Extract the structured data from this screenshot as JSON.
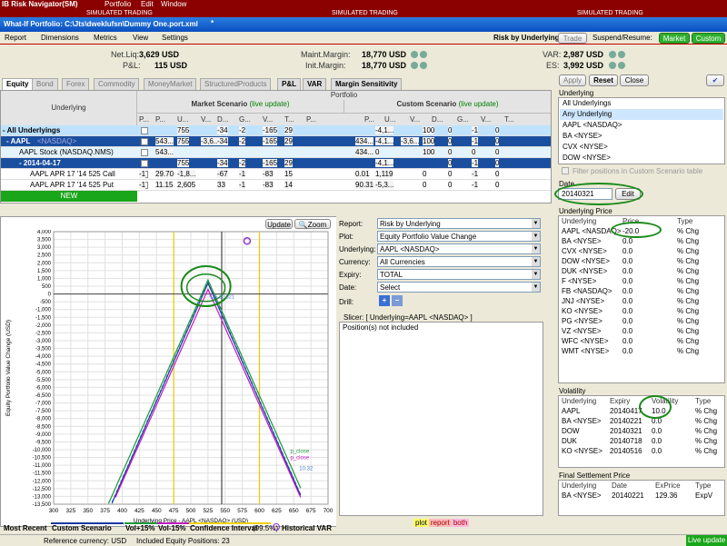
{
  "titlebar": {
    "title": "IB Risk Navigator(SM)",
    "menus": [
      "Portfolio",
      "Edit",
      "Window"
    ]
  },
  "simbar": {
    "label": "SIMULATED TRADING"
  },
  "window": {
    "title": "What-If Portfolio: C:\\Jts\\dweklufsn\\Dummy One.port.xml"
  },
  "menubar": {
    "items": [
      "Report",
      "Dimensions",
      "Metrics",
      "View",
      "Settings"
    ],
    "risk_label": "Risk by Underlying",
    "trade": "Trade",
    "suspend": "Suspend/Resume:",
    "market": "Market",
    "custom": "Custom"
  },
  "summary": {
    "netliq_l": "Net.Liq:",
    "netliq": "3,629 USD",
    "pl_l": "P&L:",
    "pl": "115 USD",
    "mm_l": "Maint.Margin:",
    "mm": "18,770 USD",
    "im_l": "Init.Margin:",
    "im": "18,770 USD",
    "var_l": "VAR:",
    "var": "2,987 USD",
    "es_l": "ES:",
    "es": "3,992 USD"
  },
  "tabs": [
    "Equity",
    "Bond",
    "Forex",
    "Commodity",
    "MoneyMarket",
    "StructuredProducts",
    "P&L",
    "VAR",
    "Margin Sensitivity"
  ],
  "grid": {
    "portfolio": "Portfolio",
    "underlying": "Underlying",
    "market": "Market Scenario",
    "custom": "Custom Scenario",
    "live": "(live update)",
    "mcols": [
      "P...",
      "P...",
      "U...",
      "V...",
      "D...",
      "G...",
      "V...",
      "T...",
      "P..."
    ],
    "ccols": [
      "P...",
      "U...",
      "V...",
      "D...",
      "G...",
      "V...",
      "T..."
    ],
    "rows": [
      {
        "name": "- All Underlyings",
        "m": [
          "",
          "",
          "755",
          "",
          "-34",
          "-2",
          "-165",
          "29",
          ""
        ],
        "c": [
          "",
          "-4,1...",
          "",
          "100",
          "0",
          "-1",
          "0"
        ]
      },
      {
        "name": "- AAPL",
        "sub": "<NASDAQ>",
        "m": [
          "",
          "543...",
          "755",
          "-3,6...",
          "-34",
          "-2",
          "-165",
          "29",
          ""
        ],
        "c": [
          "434...",
          "-4,1...",
          "-3,6...",
          "100",
          "0",
          "-1",
          "0"
        ]
      },
      {
        "name": "AAPL Stock (NASDAQ.NMS)",
        "m": [
          "",
          "543...",
          "",
          "",
          "",
          "",
          "",
          "",
          ""
        ],
        "c": [
          "434...",
          "0",
          "",
          "100",
          "0",
          "0",
          "0"
        ]
      },
      {
        "name": "- 2014-04-17",
        "m": [
          "",
          "",
          "755",
          "",
          "-34",
          "-2",
          "-165",
          "29",
          ""
        ],
        "c": [
          "",
          "-4,1...",
          "",
          "",
          "0",
          "-1",
          "0"
        ]
      },
      {
        "name": "AAPL APR 17 '14 525 Call",
        "m": [
          "-1",
          "29.70",
          "-1,8...",
          "",
          "-67",
          "-1",
          "-83",
          "15",
          ""
        ],
        "c": [
          "0.01",
          "1,119",
          "",
          "0",
          "0",
          "-1",
          "0"
        ]
      },
      {
        "name": "AAPL APR 17 '14 525 Put",
        "m": [
          "-1",
          "11.15",
          "2,605",
          "",
          "33",
          "-1",
          "-83",
          "14",
          ""
        ],
        "c": [
          "90.31",
          "-5,3...",
          "",
          "0",
          "0",
          "-1",
          "0"
        ]
      }
    ],
    "new": "NEW"
  },
  "chart": {
    "update": "Update",
    "zoom": "Zoom",
    "ylabel": "Equity Portfolio Value Change (USD)",
    "xlabel": "Underlying Price - AAPL <NASDAQ> (USD)",
    "yticks": [
      "4,000",
      "3,500",
      "3,000",
      "2,500",
      "2,000",
      "1,500",
      "1,000",
      "500",
      "0",
      "-500",
      "-1,000",
      "-1,500",
      "-2,000",
      "-2,500",
      "-3,000",
      "-3,500",
      "-4,000",
      "-4,500",
      "-5,000",
      "-5,500",
      "-6,000",
      "-6,500",
      "-7,000",
      "-7,500",
      "-8,000",
      "-8,500",
      "-9,000",
      "-9,500",
      "-10,000",
      "-10,500",
      "-11,000",
      "-11,500",
      "-12,000",
      "-12,500",
      "-13,000",
      "-13,500"
    ],
    "xticks": [
      "300",
      "325",
      "350",
      "375",
      "400",
      "425",
      "450",
      "475",
      "500",
      "525",
      "550",
      "575",
      "600",
      "625",
      "650",
      "675",
      "700"
    ],
    "annot": "525.32 321",
    "pclose1": "p_close",
    "pclose2": "p_close",
    "val": "10.32",
    "legend": {
      "most_recent": "Most Recent",
      "custom": "Custom Scenario",
      "vol_up": "Vol+15%",
      "vol_dn": "Vol-15%",
      "ci": "Confidence Interval",
      "ci_pct": "(99.5%)",
      "hvar": "Historical VAR"
    },
    "footer": {
      "plot": "plot",
      "report": "report",
      "both": "both"
    }
  },
  "controls": {
    "report_l": "Report:",
    "report": "Risk by Underlying",
    "plot_l": "Plot:",
    "plot": "Equity Portfolio Value Change",
    "und_l": "Underlying:",
    "und": "AAPL <NASDAQ>",
    "cur_l": "Currency:",
    "cur": "All Currencies",
    "exp_l": "Expiry:",
    "exp": "TOTAL",
    "date_l": "Date:",
    "date": "Select",
    "drill_l": "Drill:",
    "slicer": "Slicer: [ Underlying=AAPL <NASDAQ> ]",
    "excluded": "Position(s) not included"
  },
  "right": {
    "apply": "Apply",
    "reset": "Reset",
    "close": "Close",
    "und_title": "Underlying",
    "und_items": [
      "All Underlyings",
      "Any Underlying",
      "AAPL <NASDAQ>",
      "BA <NYSE>",
      "CVX <NYSE>",
      "DOW <NYSE>"
    ],
    "filter": "Filter positions in Custom Scenario table",
    "date_title": "Date",
    "date_val": "20140321",
    "edit": "Edit",
    "price_title": "Underlying Price",
    "price_cols": [
      "Underlying",
      "Price",
      "Type"
    ],
    "price_rows": [
      [
        "AAPL <NASDAQ>",
        "-20.0",
        "% Chg"
      ],
      [
        "BA <NYSE>",
        "0.0",
        "% Chg"
      ],
      [
        "CVX <NYSE>",
        "0.0",
        "% Chg"
      ],
      [
        "DOW <NYSE>",
        "0.0",
        "% Chg"
      ],
      [
        "DUK <NYSE>",
        "0.0",
        "% Chg"
      ],
      [
        "F <NYSE>",
        "0.0",
        "% Chg"
      ],
      [
        "FB <NASDAQ>",
        "0.0",
        "% Chg"
      ],
      [
        "JNJ <NYSE>",
        "0.0",
        "% Chg"
      ],
      [
        "KO <NYSE>",
        "0.0",
        "% Chg"
      ],
      [
        "PG <NYSE>",
        "0.0",
        "% Chg"
      ],
      [
        "VZ <NYSE>",
        "0.0",
        "% Chg"
      ],
      [
        "WFC <NYSE>",
        "0.0",
        "% Chg"
      ],
      [
        "WMT <NYSE>",
        "0.0",
        "% Chg"
      ]
    ],
    "vol_title": "Volatility",
    "vol_cols": [
      "Underlying",
      "Expiry",
      "Volatility",
      "Type"
    ],
    "vol_rows": [
      [
        "AAPL",
        "20140417",
        "10.0",
        "% Chg"
      ],
      [
        "BA <NYSE>",
        "20140221",
        "0.0",
        "% Chg"
      ],
      [
        "DOW",
        "20140321",
        "0.0",
        "% Chg"
      ],
      [
        "DUK",
        "20140718",
        "0.0",
        "% Chg"
      ],
      [
        "KO <NYSE>",
        "20140516",
        "0.0",
        "% Chg"
      ]
    ],
    "fsp_title": "Final Settlement Price",
    "fsp_cols": [
      "Underlying",
      "Date",
      "ExPrice",
      "Type"
    ],
    "fsp_rows": [
      [
        "BA <NYSE>",
        "20140221",
        "129.36",
        "ExpV"
      ]
    ]
  },
  "status": {
    "ref": "Reference currency: USD",
    "incl": "Included Equity Positions: 23",
    "live": "Live update"
  }
}
